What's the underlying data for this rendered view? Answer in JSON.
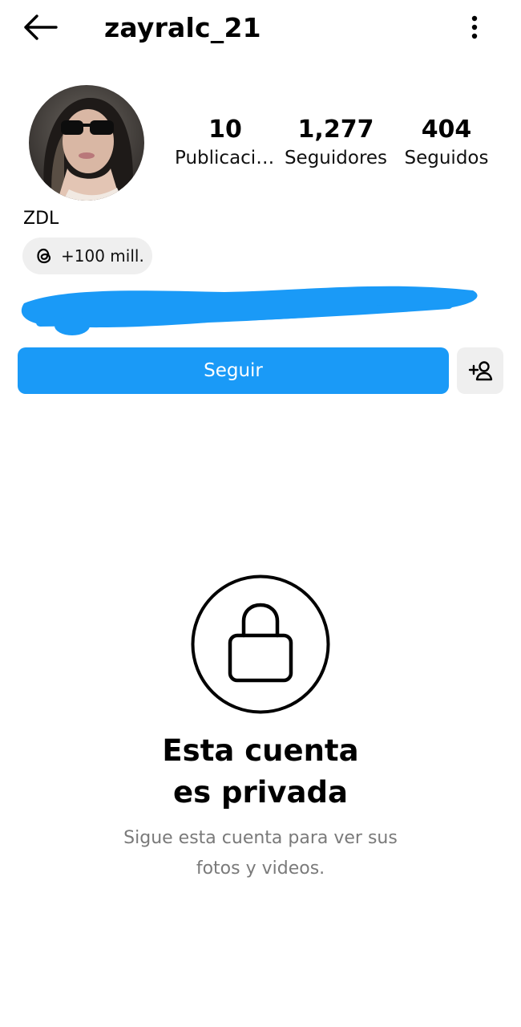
{
  "header": {
    "username": "zayralc_21",
    "back_icon": "arrow-left-icon",
    "more_icon": "more-vertical-icon"
  },
  "profile": {
    "display_name": "ZDL",
    "stats": {
      "posts": {
        "value": "10",
        "label": "Publicaciones"
      },
      "followers": {
        "value": "1,277",
        "label": "Seguidores"
      },
      "following": {
        "value": "404",
        "label": "Seguidos"
      }
    },
    "threads_badge": {
      "icon": "threads-icon",
      "count": "+100 mill."
    }
  },
  "actions": {
    "follow_label": "Seguir",
    "suggest_icon": "add-person-icon"
  },
  "private_notice": {
    "icon": "lock-icon",
    "title_line1": "Esta cuenta",
    "title_line2": "es privada",
    "subtitle_line1": "Sigue esta cuenta para ver sus",
    "subtitle_line2": "fotos y videos."
  },
  "colors": {
    "primary": "#1a9af7",
    "button_secondary": "#efefef",
    "muted_text": "#7a7a7a"
  }
}
